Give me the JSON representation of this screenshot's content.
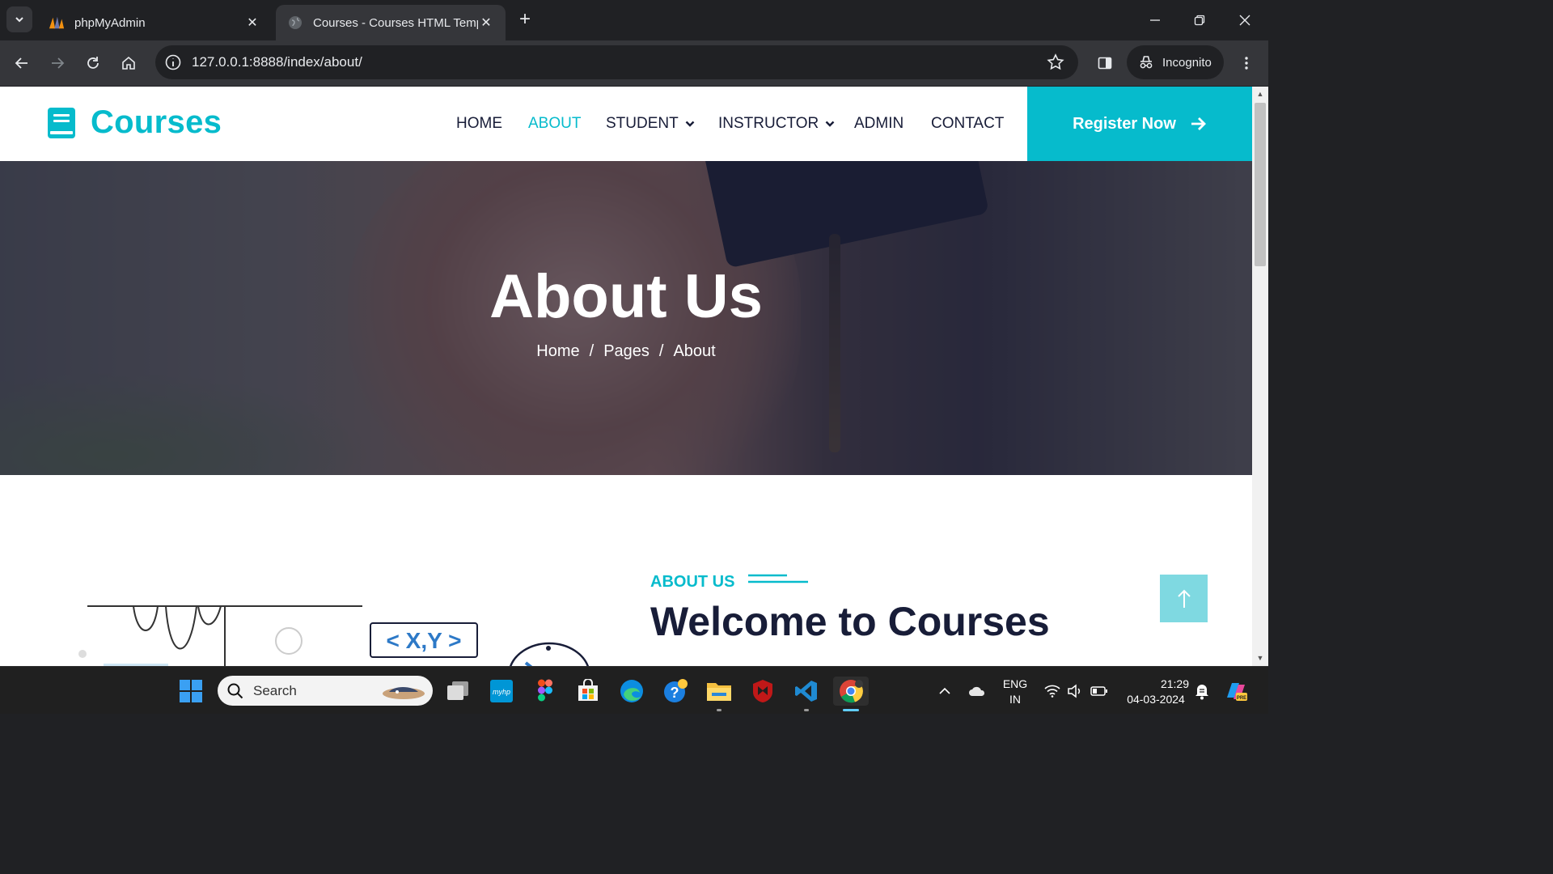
{
  "browser": {
    "tabs": [
      {
        "title": "phpMyAdmin",
        "active": false
      },
      {
        "title": "Courses - Courses HTML Templ",
        "active": true
      }
    ],
    "url": "127.0.0.1:8888/index/about/",
    "profile_label": "Incognito"
  },
  "site": {
    "logo_text": "Courses",
    "nav": [
      {
        "label": "HOME",
        "active": false,
        "dropdown": false
      },
      {
        "label": "ABOUT",
        "active": true,
        "dropdown": false
      },
      {
        "label": "STUDENT",
        "active": false,
        "dropdown": true
      },
      {
        "label": "INSTRUCTOR",
        "active": false,
        "dropdown": true
      },
      {
        "label": "ADMIN",
        "active": false,
        "dropdown": false
      },
      {
        "label": "CONTACT",
        "active": false,
        "dropdown": false
      }
    ],
    "register_label": "Register Now",
    "hero": {
      "title": "About Us",
      "breadcrumb": [
        "Home",
        "Pages",
        "About"
      ],
      "separator": "/"
    },
    "about": {
      "label": "ABOUT US",
      "title": "Welcome to Courses",
      "illustration_text": "< X,Y >"
    },
    "colors": {
      "primary": "#06bbcc",
      "dark": "#181d38"
    }
  },
  "taskbar": {
    "search_placeholder": "Search",
    "language": "ENG",
    "region": "IN",
    "time": "21:29",
    "date": "04-03-2024"
  }
}
